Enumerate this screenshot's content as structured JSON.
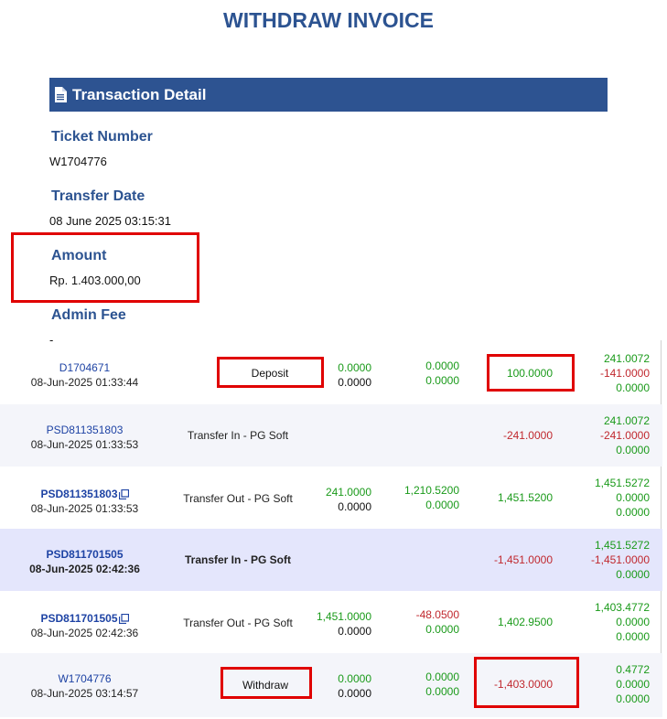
{
  "page": {
    "title": "WITHDRAW INVOICE"
  },
  "detail": {
    "header": "Transaction Detail",
    "header_icon": "document-icon",
    "fields": [
      {
        "label": "Ticket Number",
        "value": "W1704776"
      },
      {
        "label": "Transfer Date",
        "value": "08 June 2025 03:15:31"
      },
      {
        "label": "Amount",
        "value": "Rp. 1.403.000,00"
      },
      {
        "label": "Admin Fee",
        "value": "-"
      }
    ]
  },
  "colors": {
    "primary": "#2d5391",
    "positive": "#1a9a1a",
    "negative": "#c0282e",
    "highlight": "#e00000"
  },
  "rows": [
    {
      "ticket": "D1704671",
      "time": "08-Jun-2025 01:33:44",
      "desc": "Deposit",
      "a": [
        "0.0000",
        "0.0000"
      ],
      "b": [
        "0.0000",
        "0.0000"
      ],
      "c": "100.0000",
      "d": [
        "241.0072",
        "-141.0000",
        "0.0000"
      ]
    },
    {
      "ticket": "PSD811351803",
      "time": "08-Jun-2025 01:33:53",
      "desc": "Transfer In - PG Soft",
      "a": [
        "",
        ""
      ],
      "b": [
        "",
        ""
      ],
      "c": "-241.0000",
      "d": [
        "241.0072",
        "-241.0000",
        "0.0000"
      ]
    },
    {
      "ticket": "PSD811351803",
      "time": "08-Jun-2025 01:33:53",
      "desc": "Transfer Out - PG Soft",
      "a": [
        "241.0000",
        "0.0000"
      ],
      "b": [
        "1,210.5200",
        "0.0000"
      ],
      "c": "1,451.5200",
      "d": [
        "1,451.5272",
        "0.0000",
        "0.0000"
      ]
    },
    {
      "ticket": "PSD811701505",
      "time": "08-Jun-2025 02:42:36",
      "desc": "Transfer In - PG Soft",
      "a": [
        "",
        ""
      ],
      "b": [
        "",
        ""
      ],
      "c": "-1,451.0000",
      "d": [
        "1,451.5272",
        "-1,451.0000",
        "0.0000"
      ]
    },
    {
      "ticket": "PSD811701505",
      "time": "08-Jun-2025 02:42:36",
      "desc": "Transfer Out - PG Soft",
      "a": [
        "1,451.0000",
        "0.0000"
      ],
      "b": [
        "-48.0500",
        "0.0000"
      ],
      "c": "1,402.9500",
      "d": [
        "1,403.4772",
        "0.0000",
        "0.0000"
      ]
    },
    {
      "ticket": "W1704776",
      "time": "08-Jun-2025 03:14:57",
      "desc": "Withdraw",
      "a": [
        "0.0000",
        "0.0000"
      ],
      "b": [
        "0.0000",
        "0.0000"
      ],
      "c": "-1,403.0000",
      "d": [
        "0.4772",
        "0.0000",
        "0.0000"
      ]
    }
  ]
}
